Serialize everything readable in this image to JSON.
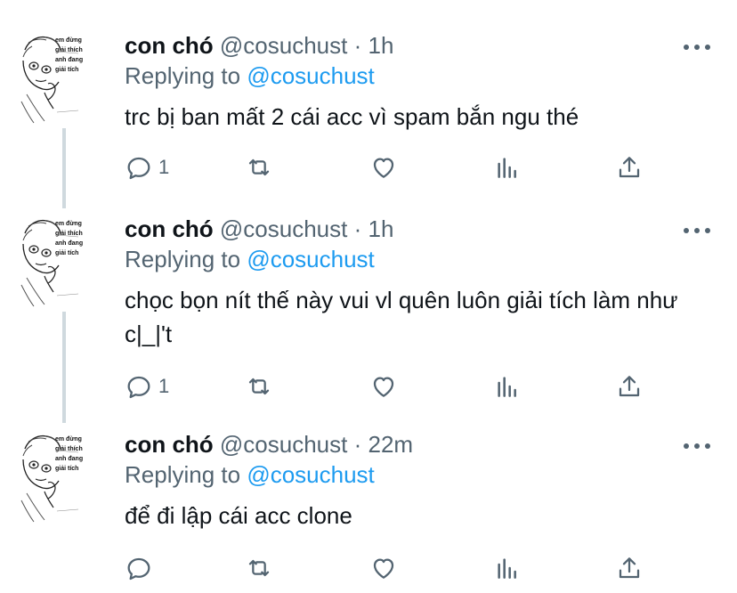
{
  "tweets": [
    {
      "name": "con chó",
      "handle": "@cosuchust",
      "dot": "·",
      "time": "1h",
      "replying_prefix": "Replying to",
      "replying_to": "@cosuchust",
      "text": "trc bị ban mất 2 cái acc vì spam bắn ngu thé",
      "reply_count": "1"
    },
    {
      "name": "con chó",
      "handle": "@cosuchust",
      "dot": "·",
      "time": "1h",
      "replying_prefix": "Replying to",
      "replying_to": "@cosuchust",
      "text": "chọc bọn nít thế này vui vl quên luôn giải tích làm như c|_|'t",
      "reply_count": "1"
    },
    {
      "name": "con chó",
      "handle": "@cosuchust",
      "dot": "·",
      "time": "22m",
      "replying_prefix": "Replying to",
      "replying_to": "@cosuchust",
      "text": "để đi lập cái acc clone",
      "reply_count": ""
    }
  ],
  "avatar_caption": [
    "em đừng",
    "giải thích",
    "anh đang",
    "giải tích"
  ],
  "icons": {
    "more": "more-icon",
    "reply": "reply-icon",
    "retweet": "retweet-icon",
    "like": "like-icon",
    "analytics": "analytics-icon",
    "share": "share-icon"
  },
  "colors": {
    "text": "#0f1419",
    "muted": "#536471",
    "accent": "#1d9bf0",
    "thread": "#cfd9de"
  }
}
